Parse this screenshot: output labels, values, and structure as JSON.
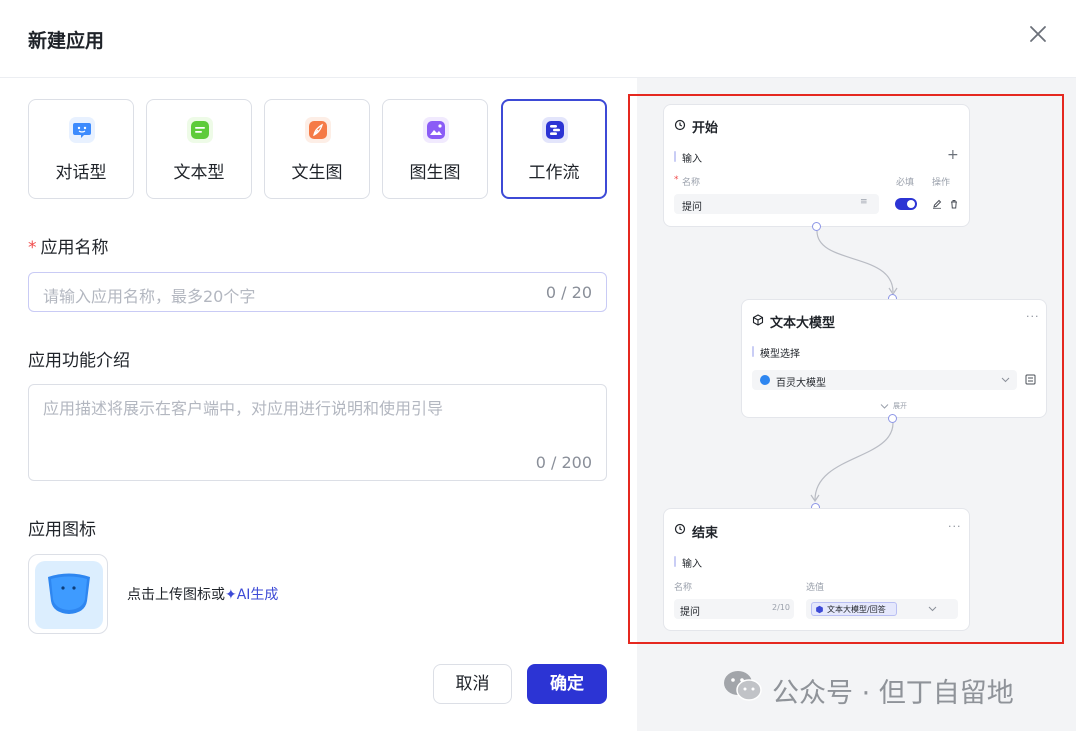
{
  "dialog": {
    "title": "新建应用"
  },
  "app_types": [
    {
      "label": "对话型",
      "icon": "chat-bubble-icon",
      "color": "#3d8bfd",
      "selected": false
    },
    {
      "label": "文本型",
      "icon": "text-lines-icon",
      "color": "#5ecb3a",
      "selected": false
    },
    {
      "label": "文生图",
      "icon": "brush-icon",
      "color": "#f57a46",
      "selected": false
    },
    {
      "label": "图生图",
      "icon": "image-icon",
      "color": "#8b5cf6",
      "selected": false
    },
    {
      "label": "工作流",
      "icon": "workflow-icon",
      "color": "#2c34d4",
      "selected": true
    }
  ],
  "form": {
    "name": {
      "label": "应用名称",
      "required": "*",
      "placeholder": "请输入应用名称，最多20个字",
      "counter": "0 / 20"
    },
    "description": {
      "label": "应用功能介绍",
      "placeholder": "应用描述将展示在客户端中，对应用进行说明和使用引导",
      "counter": "0 / 200"
    },
    "icon": {
      "label": "应用图标",
      "upload_hint": "点击上传图标或",
      "ai_link": "✦AI生成"
    }
  },
  "buttons": {
    "cancel": "取消",
    "confirm": "确定"
  },
  "preview": {
    "start_node": {
      "title": "开始",
      "section": "输入",
      "col_name": "名称",
      "col_required_mark": "*",
      "col_required": "必填",
      "col_actions": "操作",
      "row_name": "提问",
      "required_on": true
    },
    "llm_node": {
      "title": "文本大模型",
      "section": "模型选择",
      "model": "百灵大模型",
      "expand": "展开"
    },
    "end_node": {
      "title": "结束",
      "section": "输入",
      "col_name": "名称",
      "col_value": "选值",
      "row_name": "提问",
      "row_counter": "2/10",
      "row_value": "文本大模型/回答"
    }
  },
  "watermark": {
    "text": "公众号 · 但丁自留地"
  },
  "colors": {
    "accent": "#2c34d4",
    "highlight_frame": "#e5281f",
    "required": "#f04b4b"
  }
}
